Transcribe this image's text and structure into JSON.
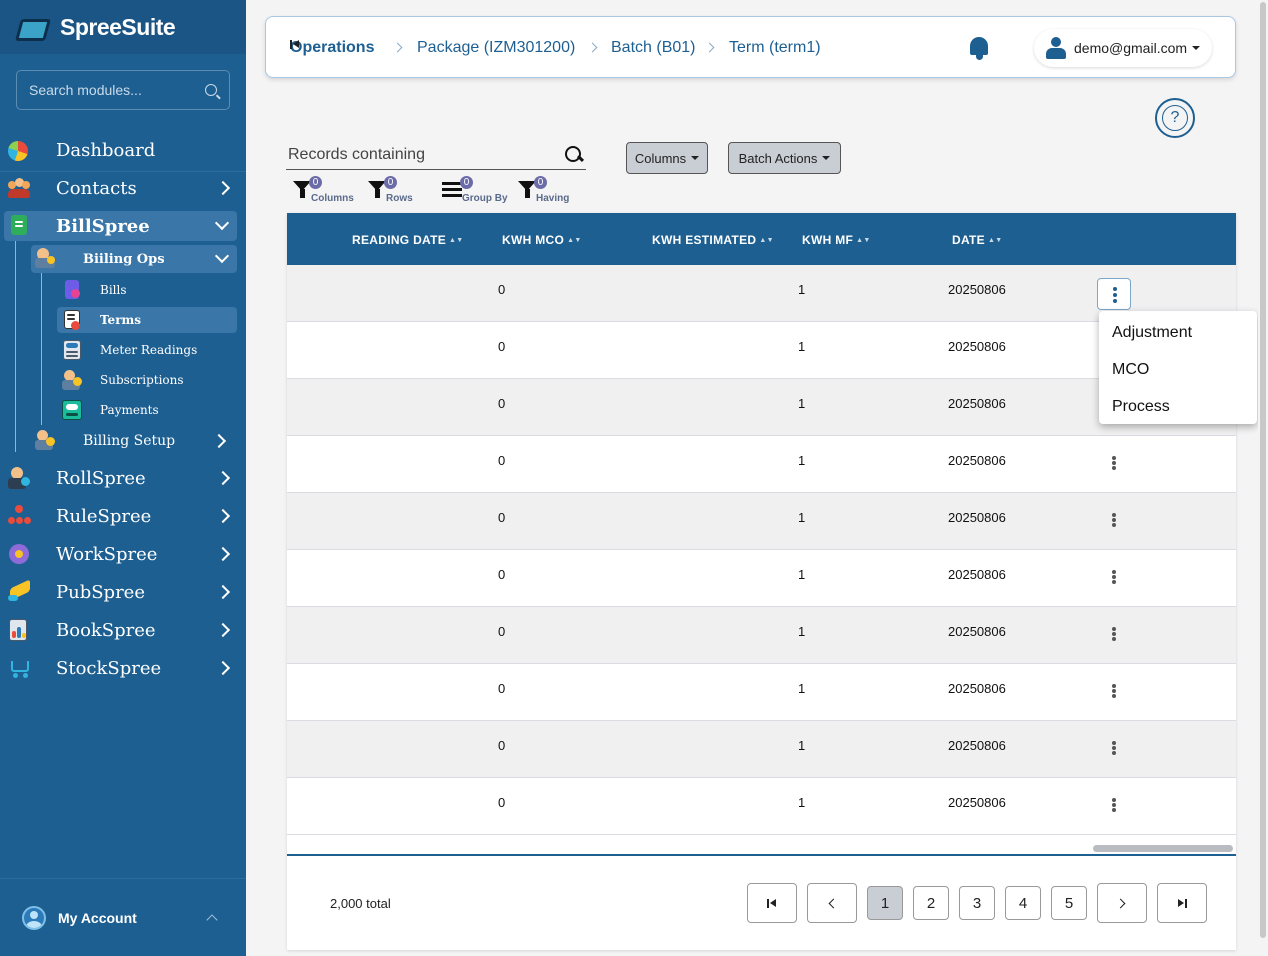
{
  "brand": {
    "name": "SpreeSuite"
  },
  "search": {
    "placeholder": "Search modules..."
  },
  "nav": {
    "dashboard": "Dashboard",
    "contacts": "Contacts",
    "billspree": "BillSpree",
    "billing_ops": "Biiling Ops",
    "bills": "Bills",
    "terms": "Terms",
    "meter_readings": "Meter Readings",
    "subscriptions": "Subscriptions",
    "payments": "Payments",
    "billing_setup": "Billing Setup",
    "rollspree": "RollSpree",
    "rulespree": "RuleSpree",
    "workspree": "WorkSpree",
    "pubspree": "PubSpree",
    "bookspree": "BookSpree",
    "stockspree": "StockSpree"
  },
  "account": {
    "label": "My Account"
  },
  "breadcrumb": {
    "root": "Operations",
    "package": "Package (IZM301200)",
    "batch": "Batch (B01)",
    "term": "Term (term1)"
  },
  "user": {
    "email": "demo@gmail.com"
  },
  "help": {
    "glyph": "?"
  },
  "toolbar": {
    "records_placeholder": "Records containing",
    "columns_btn": "Columns",
    "batch_actions_btn": "Batch Actions",
    "filters": [
      {
        "label": "Columns",
        "count": "0"
      },
      {
        "label": "Rows",
        "count": "0"
      },
      {
        "label": "Group By",
        "count": "0"
      },
      {
        "label": "Having",
        "count": "0"
      }
    ]
  },
  "table": {
    "headers": [
      "READING DATE",
      "KWH MCO",
      "KWH ESTIMATED",
      "KWH MF",
      "DATE"
    ],
    "sort_glyph": "▲▼",
    "rows": [
      {
        "kwh_mco": "0",
        "kwh_mf": "1",
        "date": "20250806"
      },
      {
        "kwh_mco": "0",
        "kwh_mf": "1",
        "date": "20250806"
      },
      {
        "kwh_mco": "0",
        "kwh_mf": "1",
        "date": "20250806"
      },
      {
        "kwh_mco": "0",
        "kwh_mf": "1",
        "date": "20250806"
      },
      {
        "kwh_mco": "0",
        "kwh_mf": "1",
        "date": "20250806"
      },
      {
        "kwh_mco": "0",
        "kwh_mf": "1",
        "date": "20250806"
      },
      {
        "kwh_mco": "0",
        "kwh_mf": "1",
        "date": "20250806"
      },
      {
        "kwh_mco": "0",
        "kwh_mf": "1",
        "date": "20250806"
      },
      {
        "kwh_mco": "0",
        "kwh_mf": "1",
        "date": "20250806"
      },
      {
        "kwh_mco": "0",
        "kwh_mf": "1",
        "date": "20250806"
      }
    ]
  },
  "row_menu": {
    "options": [
      "Adjustment",
      "MCO",
      "Process"
    ]
  },
  "pagination": {
    "total": "2,000 total",
    "pages": [
      "1",
      "2",
      "3",
      "4",
      "5"
    ],
    "current": "1"
  },
  "colors": {
    "sidebar": "#1e5f92",
    "header_row": "#1e5f92",
    "accent": "#1e5f92",
    "button_gray": "#c9cdd4"
  }
}
